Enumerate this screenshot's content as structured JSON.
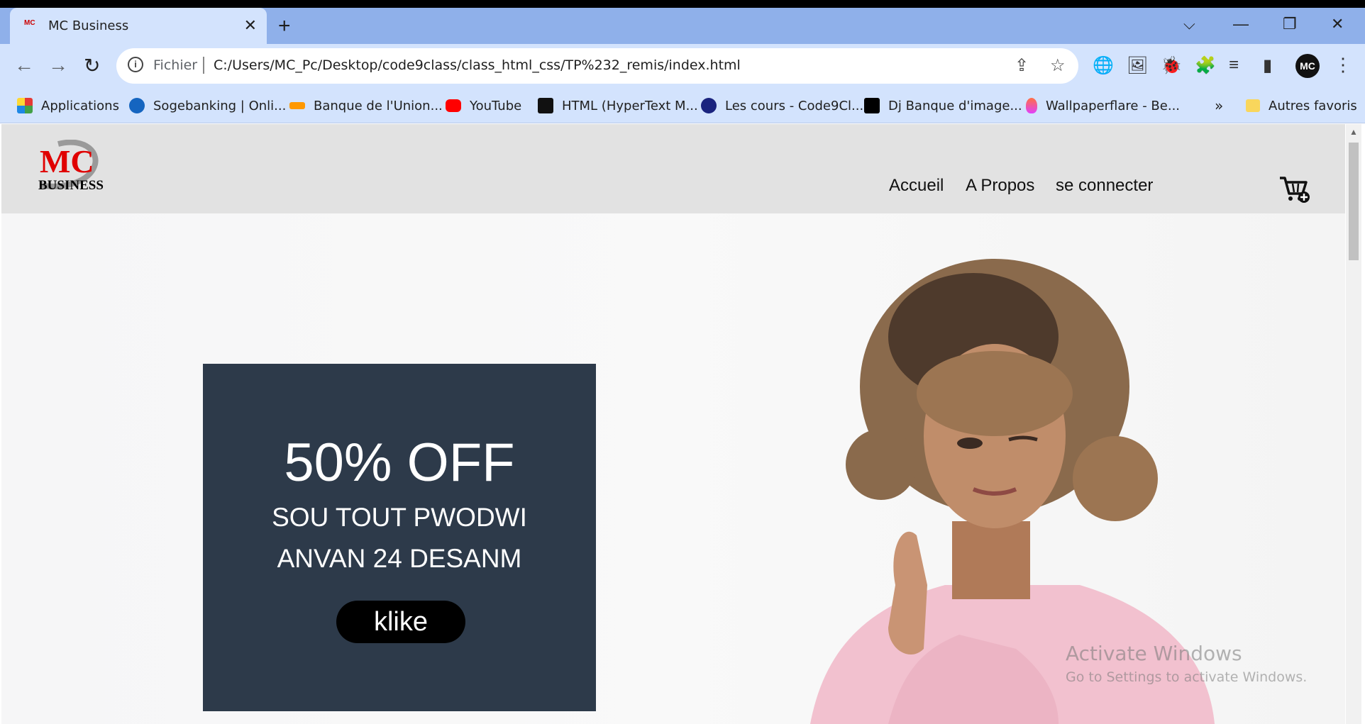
{
  "tab": {
    "title": "MC Business",
    "favicon_text": "MC",
    "close_icon": "✕"
  },
  "newtab_icon": "+",
  "window_controls": {
    "dropdown": "⌵",
    "minimize": "—",
    "restore": "❐",
    "close": "✕"
  },
  "nav": {
    "back": "←",
    "forward": "→",
    "reload": "↻"
  },
  "omnibox": {
    "info_icon": "i",
    "scheme": "Fichier",
    "url": "C:/Users/MC_Pc/Desktop/code9class/class_html_css/TP%232_remis/index.html",
    "share_icon": "⇪",
    "star_icon": "☆"
  },
  "extensions": [
    "🌐",
    "🖼",
    "🐞",
    "🧩",
    "≡",
    "▮"
  ],
  "profile_initials": "MC",
  "menu_icon": "⋮",
  "bookmarks": [
    {
      "label": "Applications",
      "color": "#e53935"
    },
    {
      "label": "Sogebanking | Onli...",
      "color": "#1565c0"
    },
    {
      "label": "Banque de l'Union...",
      "color": "#ff9800"
    },
    {
      "label": "YouTube",
      "color": "#ff0000"
    },
    {
      "label": "HTML (HyperText M...",
      "color": "#111111"
    },
    {
      "label": "Les cours - Code9Cl...",
      "color": "#1a237e"
    },
    {
      "label": "Dj Banque d'image...",
      "color": "#000000"
    },
    {
      "label": "Wallpaperflare - Be...",
      "color": "#e040fb"
    }
  ],
  "bookmarks_more": "»",
  "other_bookmarks": "Autres favoris",
  "site": {
    "logo_text_top": "MC",
    "logo_text_bottom": "BUSINESS",
    "nav_links": [
      "Accueil",
      "A Propos",
      "se connecter"
    ],
    "promo": {
      "headline": "50% OFF",
      "line1": "SOU TOUT PWODWI",
      "line2": "ANVAN 24 DESANM",
      "button": "klike"
    }
  },
  "watermark": {
    "title": "Activate Windows",
    "subtitle": "Go to Settings to activate Windows."
  }
}
